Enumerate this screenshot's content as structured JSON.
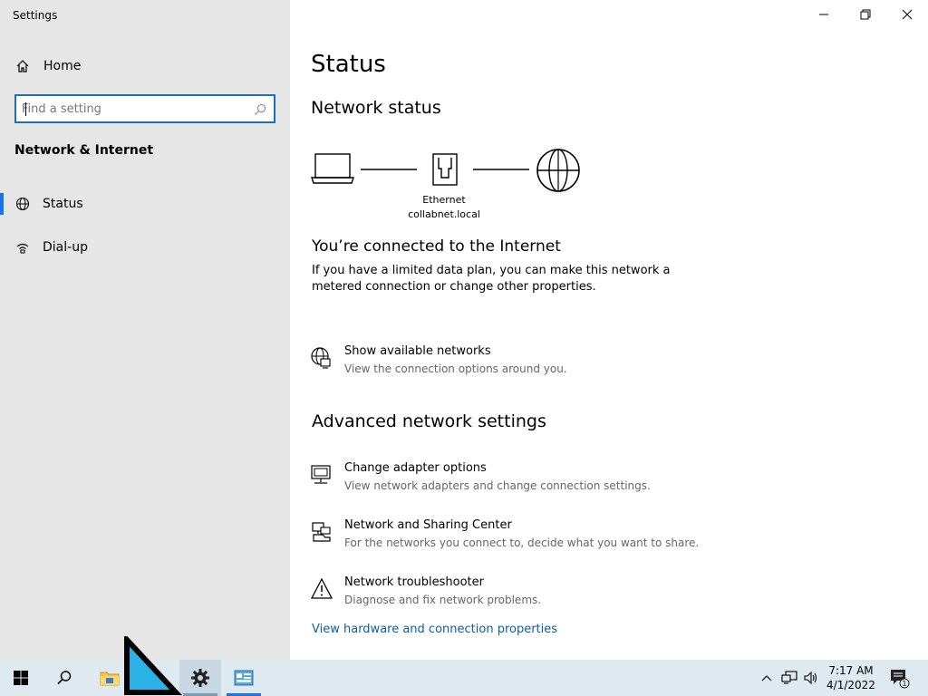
{
  "window": {
    "title": "Settings"
  },
  "sidebar": {
    "home_label": "Home",
    "search_placeholder": "Find a setting",
    "section_title": "Network & Internet",
    "items": [
      {
        "label": "Status",
        "icon": "globe-icon",
        "selected": true
      },
      {
        "label": "Dial-up",
        "icon": "dialup-icon",
        "selected": false
      }
    ]
  },
  "main": {
    "page_title": "Status",
    "network_status_heading": "Network status",
    "diagram": {
      "adapter_name": "Ethernet",
      "network_name": "collabnet.local"
    },
    "connected_heading": "You’re connected to the Internet",
    "connected_desc": "If you have a limited data plan, you can make this network a metered connection or change other properties.",
    "show_networks": {
      "title": "Show available networks",
      "subtitle": "View the connection options around you."
    },
    "advanced_heading": "Advanced network settings",
    "advanced_items": [
      {
        "title": "Change adapter options",
        "subtitle": "View network adapters and change connection settings.",
        "icon": "adapter-icon"
      },
      {
        "title": "Network and Sharing Center",
        "subtitle": "For the networks you connect to, decide what you want to share.",
        "icon": "sharing-center-icon"
      },
      {
        "title": "Network troubleshooter",
        "subtitle": "Diagnose and fix network problems.",
        "icon": "warning-icon"
      }
    ],
    "hardware_link": "View hardware and connection properties"
  },
  "taskbar": {
    "time": "7:17 AM",
    "date": "4/1/2022",
    "notification_count": "1"
  },
  "colors": {
    "accent": "#1a73e8",
    "link": "#0b5ea8",
    "sidebar_bg": "#e6e6e6",
    "taskbar_bg": "#dfe9f0"
  }
}
